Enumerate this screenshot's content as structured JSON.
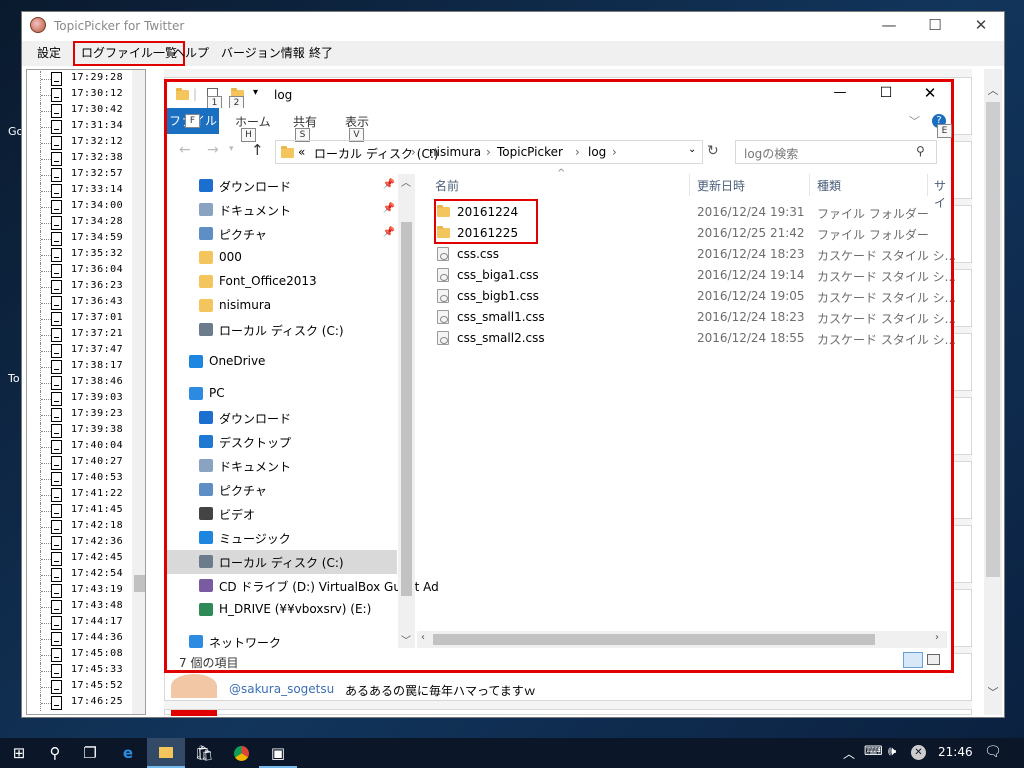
{
  "desktop": {
    "icons": [
      "Go",
      "To"
    ]
  },
  "app": {
    "title": "TopicPicker for Twitter",
    "window_buttons": [
      "—",
      "☐",
      "✕"
    ],
    "menu": [
      "設定",
      "ログファイル一覧",
      "ヘルプ",
      "バージョン情報",
      "終了"
    ],
    "log_times": [
      "17:29:28",
      "17:30:12",
      "17:30:42",
      "17:31:34",
      "17:32:12",
      "17:32:38",
      "17:32:57",
      "17:33:14",
      "17:34:00",
      "17:34:28",
      "17:34:59",
      "17:35:32",
      "17:36:04",
      "17:36:23",
      "17:36:43",
      "17:37:01",
      "17:37:21",
      "17:37:47",
      "17:38:17",
      "17:38:46",
      "17:39:03",
      "17:39:23",
      "17:39:38",
      "17:40:04",
      "17:40:27",
      "17:40:53",
      "17:41:22",
      "17:41:45",
      "17:42:18",
      "17:42:36",
      "17:42:45",
      "17:42:54",
      "17:43:19",
      "17:43:48",
      "17:44:17",
      "17:44:36",
      "17:45:08",
      "17:45:33",
      "17:45:52",
      "17:46:25"
    ],
    "feed_partial_user": "@sakura_sogetsu",
    "feed_partial_text": "あるあるの罠に毎年ハマってますｗ"
  },
  "explorer": {
    "title": "log",
    "quick_keytips": [
      "1",
      "2"
    ],
    "ribbon_tabs": [
      {
        "label": "ファイル",
        "key": "F"
      },
      {
        "label": "ホーム",
        "key": "H"
      },
      {
        "label": "共有",
        "key": "S"
      },
      {
        "label": "表示",
        "key": "V"
      }
    ],
    "help_key": "E",
    "breadcrumb": [
      "«",
      "ローカル ディスク (C:)",
      "nisimura",
      "TopicPicker",
      "log"
    ],
    "search_placeholder": "logの検索",
    "nav_items": [
      {
        "label": "ダウンロード",
        "icon": "download-icon",
        "pinned": true
      },
      {
        "label": "ドキュメント",
        "icon": "documents-icon",
        "pinned": true
      },
      {
        "label": "ピクチャ",
        "icon": "pictures-icon",
        "pinned": true
      },
      {
        "label": "000",
        "icon": "folder-icon",
        "pinned": false
      },
      {
        "label": "Font_Office2013",
        "icon": "folder-icon",
        "pinned": false
      },
      {
        "label": "nisimura",
        "icon": "folder-icon",
        "pinned": false
      },
      {
        "label": "ローカル ディスク (C:)",
        "icon": "drive-icon",
        "pinned": false
      },
      {
        "label": "OneDrive",
        "icon": "onedrive-icon",
        "pinned": false
      },
      {
        "label": "PC",
        "icon": "pc-icon",
        "pinned": false
      },
      {
        "label": "ダウンロード",
        "icon": "download-icon",
        "pinned": false
      },
      {
        "label": "デスクトップ",
        "icon": "desktop-icon",
        "pinned": false
      },
      {
        "label": "ドキュメント",
        "icon": "documents-icon",
        "pinned": false
      },
      {
        "label": "ピクチャ",
        "icon": "pictures-icon",
        "pinned": false
      },
      {
        "label": "ビデオ",
        "icon": "video-icon",
        "pinned": false
      },
      {
        "label": "ミュージック",
        "icon": "music-icon",
        "pinned": false
      },
      {
        "label": "ローカル ディスク (C:)",
        "icon": "drive-icon",
        "pinned": false
      },
      {
        "label": "CD ドライブ (D:) VirtualBox Guest Ad",
        "icon": "cd-drive-icon",
        "pinned": false
      },
      {
        "label": "H_DRIVE (¥¥vboxsrv) (E:)",
        "icon": "network-drive-icon",
        "pinned": false
      },
      {
        "label": "ネットワーク",
        "icon": "network-icon",
        "pinned": false
      }
    ],
    "columns": {
      "name": "名前",
      "date": "更新日時",
      "type": "種類",
      "size": "サイ"
    },
    "files": [
      {
        "name": "20161224",
        "date": "2016/12/24 19:31",
        "type": "ファイル フォルダー",
        "kind": "folder"
      },
      {
        "name": "20161225",
        "date": "2016/12/25 21:42",
        "type": "ファイル フォルダー",
        "kind": "folder"
      },
      {
        "name": "css.css",
        "date": "2016/12/24 18:23",
        "type": "カスケード スタイル シ...",
        "kind": "css"
      },
      {
        "name": "css_biga1.css",
        "date": "2016/12/24 19:14",
        "type": "カスケード スタイル シ...",
        "kind": "css"
      },
      {
        "name": "css_bigb1.css",
        "date": "2016/12/24 19:05",
        "type": "カスケード スタイル シ...",
        "kind": "css"
      },
      {
        "name": "css_small1.css",
        "date": "2016/12/24 18:23",
        "type": "カスケード スタイル シ...",
        "kind": "css"
      },
      {
        "name": "css_small2.css",
        "date": "2016/12/24 18:55",
        "type": "カスケード スタイル シ...",
        "kind": "css"
      }
    ],
    "status": "7 個の項目"
  },
  "taskbar": {
    "clock": "21:46"
  },
  "colors": {
    "highlight": "#e00000",
    "ribbon_file": "#1a6fc0",
    "folder": "#f4c55c"
  }
}
